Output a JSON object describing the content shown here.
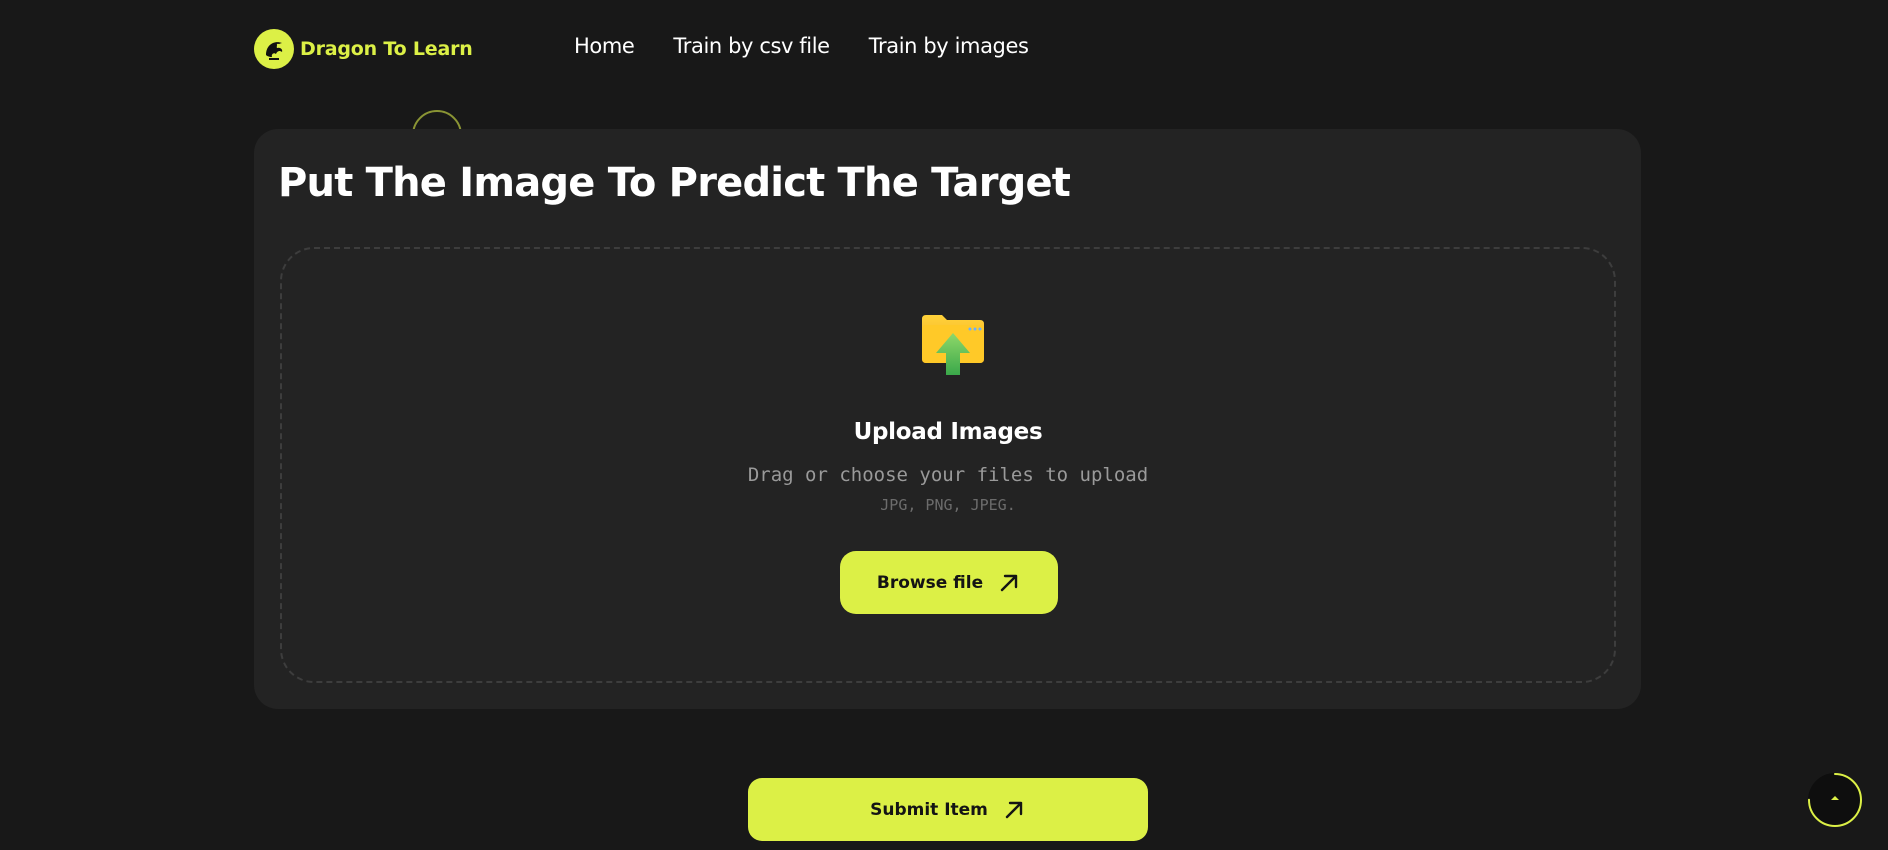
{
  "header": {
    "logo_text": "Dragon To Learn",
    "nav": [
      {
        "label": "Home"
      },
      {
        "label": "Train by csv file"
      },
      {
        "label": "Train by images"
      }
    ]
  },
  "main": {
    "title": "Put The Image To Predict The Target",
    "dropzone": {
      "icon": "folder-upload-icon",
      "title": "Upload Images",
      "subtitle": "Drag or choose your files to upload",
      "types": "JPG, PNG, JPEG."
    },
    "browse_label": "Browse file",
    "submit_label": "Submit Item"
  },
  "scroll_top": {
    "icon": "chevron-up-icon",
    "progress": 0.75
  },
  "colors": {
    "accent": "#dcf046",
    "background": "#181818",
    "card": "#232323"
  }
}
